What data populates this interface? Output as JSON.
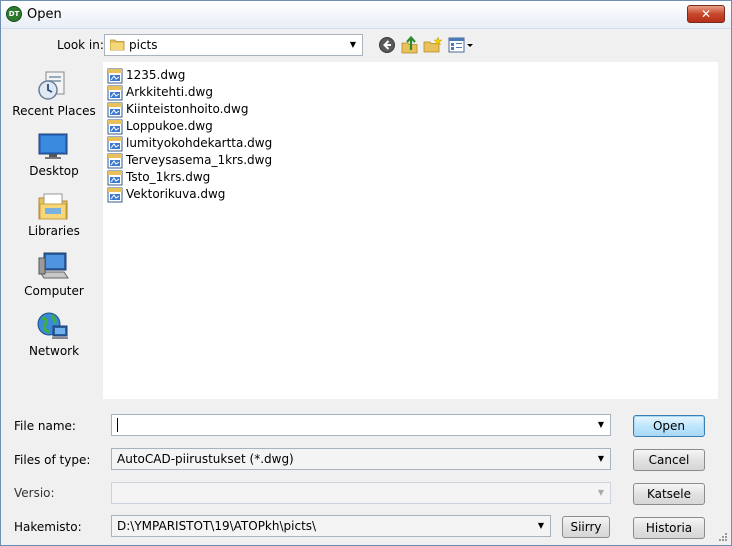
{
  "window": {
    "title": "Open",
    "app_icon_text": "DT",
    "close_glyph": "✕"
  },
  "lookin": {
    "label": "Look in:",
    "value": "picts"
  },
  "toolbar": {
    "icons": [
      "back-icon",
      "up-folder-icon",
      "new-folder-icon",
      "views-menu-icon"
    ]
  },
  "places": [
    {
      "label": "Recent Places",
      "icon": "recent-places-icon"
    },
    {
      "label": "Desktop",
      "icon": "desktop-icon"
    },
    {
      "label": "Libraries",
      "icon": "libraries-icon"
    },
    {
      "label": "Computer",
      "icon": "computer-icon"
    },
    {
      "label": "Network",
      "icon": "network-icon"
    }
  ],
  "files": [
    "1235.dwg",
    "Arkkitehti.dwg",
    "Kiinteistonhoito.dwg",
    "Loppukoe.dwg",
    "lumityokohdekartta.dwg",
    "Terveysasema_1krs.dwg",
    "Tsto_1krs.dwg",
    "Vektorikuva.dwg"
  ],
  "form": {
    "filename_label": "File name:",
    "filename_value": "",
    "filetype_label": "Files of type:",
    "filetype_value": "AutoCAD-piirustukset (*.dwg)",
    "versio_label": "Versio:",
    "versio_value": "",
    "hakemisto_label": "Hakemisto:",
    "hakemisto_value": "D:\\YMPARISTOT\\19\\ATOPkh\\picts\\"
  },
  "buttons": {
    "open": "Open",
    "cancel": "Cancel",
    "katsele": "Katsele",
    "siirry": "Siirry",
    "historia": "Historia"
  },
  "colors": {
    "accent": "#3c7fb1",
    "close": "#c7472a",
    "folder": "#e8c15a"
  }
}
